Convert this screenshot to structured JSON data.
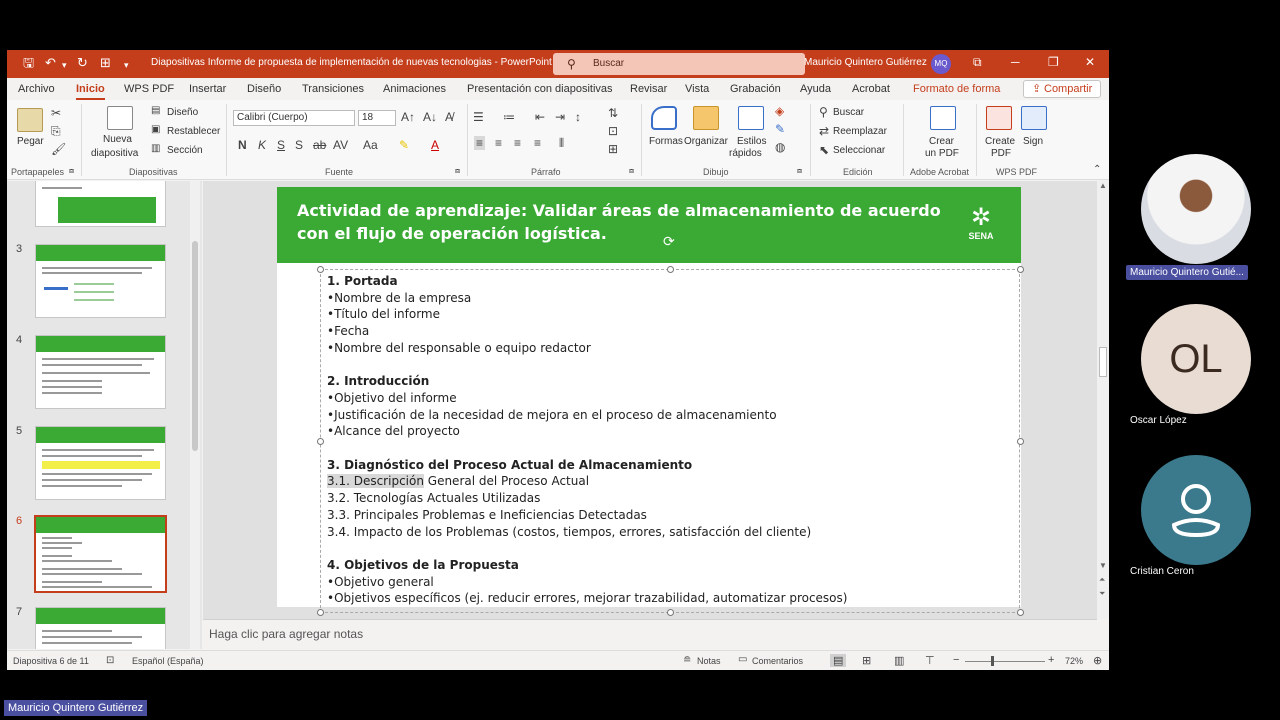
{
  "window": {
    "title": "Diapositivas Informe de propuesta de implementación de nuevas tecnologias  -  PowerPoint",
    "search_placeholder": "Buscar",
    "user_name": "Mauricio Quintero Gutiérrez",
    "user_initials": "MQ"
  },
  "tabs": [
    "Archivo",
    "Inicio",
    "WPS PDF",
    "Insertar",
    "Diseño",
    "Transiciones",
    "Animaciones",
    "Presentación con diapositivas",
    "Revisar",
    "Vista",
    "Grabación",
    "Ayuda",
    "Acrobat",
    "Formato de forma"
  ],
  "share_label": "Compartir",
  "ribbon": {
    "pegar": "Pegar",
    "nueva1": "Nueva",
    "nueva2": "diapositiva",
    "diseno": "Diseño",
    "restablecer": "Restablecer",
    "seccion": "Sección",
    "font_name": "Calibri (Cuerpo)",
    "font_size": "18",
    "formas": "Formas",
    "organizar": "Organizar",
    "estilos1": "Estilos",
    "estilos2": "rápidos",
    "buscar": "Buscar",
    "reemplazar": "Reemplazar",
    "seleccionar": "Seleccionar",
    "crear1": "Crear",
    "crear2": "un PDF",
    "create1": "Create",
    "create2": "PDF",
    "sign": "Sign",
    "groups": {
      "portapapeles": "Portapapeles",
      "diapositivas": "Diapositivas",
      "fuente": "Fuente",
      "parrafo": "Párrafo",
      "dibujo": "Dibujo",
      "edicion": "Edición",
      "adobe": "Adobe Acrobat",
      "wps": "WPS PDF"
    }
  },
  "thumbnails": [
    {
      "num": "3"
    },
    {
      "num": "4"
    },
    {
      "num": "5"
    },
    {
      "num": "6"
    },
    {
      "num": "7"
    }
  ],
  "slide": {
    "title": "Actividad de aprendizaje: Validar áreas de almacenamiento de acuerdo con el flujo de operación logística.",
    "logo_text": "SENA",
    "lines": {
      "s1": "1. Portada",
      "s1a": "•Nombre de la empresa",
      "s1b": "•Título del informe",
      "s1c": "•Fecha",
      "s1d": "•Nombre del responsable o equipo redactor",
      "s2": "2. Introducción",
      "s2a": "•Objetivo del informe",
      "s2b": "•Justificación de la necesidad de mejora en el proceso de almacenamiento",
      "s2c": "•Alcance del proyecto",
      "s3": "3. Diagnóstico del Proceso Actual de Almacenamiento",
      "s3a_hl": "3.1. Descripción",
      "s3a_rest": " General del Proceso Actual",
      "s3b": "3.2. Tecnologías Actuales Utilizadas",
      "s3c": "3.3. Principales Problemas e Ineficiencias Detectadas",
      "s3d": "3.4. Impacto de los Problemas (costos, tiempos, errores, satisfacción del cliente)",
      "s4": "4. Objetivos de la Propuesta",
      "s4a": "•Objetivo general",
      "s4b": "•Objetivos específicos (ej. reducir errores, mejorar trazabilidad, automatizar procesos)"
    }
  },
  "notes_placeholder": "Haga clic para agregar notas",
  "status": {
    "slide_counter": "Diapositiva 6 de 11",
    "language": "Español (España)",
    "notas": "Notas",
    "comentarios": "Comentarios",
    "zoom": "72%"
  },
  "participants": [
    {
      "name": "Mauricio Quintero Gutié..."
    },
    {
      "name": "Oscar López",
      "initials": "OL"
    },
    {
      "name": "Cristian Ceron"
    }
  ],
  "presenter_label": "Mauricio Quintero Gutiérrez"
}
